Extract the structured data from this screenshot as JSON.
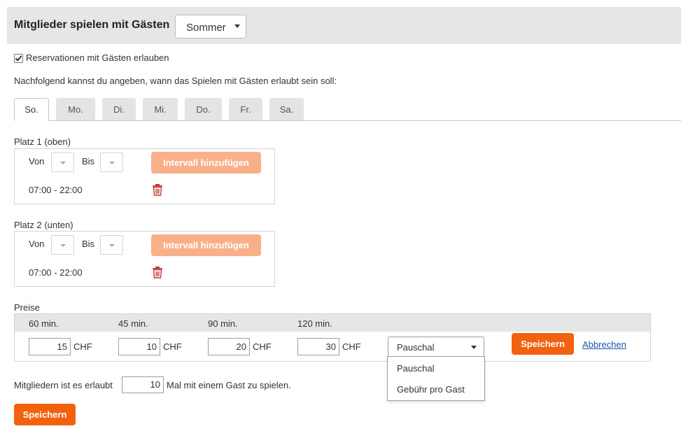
{
  "header": {
    "title": "Mitglieder spielen mit Gästen",
    "season_value": "Sommer"
  },
  "allow_guests": {
    "checked": true,
    "label": "Reservationen mit Gästen erlauben"
  },
  "intro_text": "Nachfolgend kannst du angeben, wann das Spielen mit Gästen erlaubt sein soll:",
  "tabs": [
    {
      "label": "So.",
      "active": true
    },
    {
      "label": "Mo.",
      "active": false
    },
    {
      "label": "Di.",
      "active": false
    },
    {
      "label": "Mi.",
      "active": false
    },
    {
      "label": "Do.",
      "active": false
    },
    {
      "label": "Fr.",
      "active": false
    },
    {
      "label": "Sa.",
      "active": false
    }
  ],
  "courts": [
    {
      "label": "Platz 1 (oben)",
      "from_label": "Von",
      "to_label": "Bis",
      "add_button": "Intervall hinzufügen",
      "intervals": [
        "07:00 - 22:00"
      ]
    },
    {
      "label": "Platz 2 (unten)",
      "from_label": "Von",
      "to_label": "Bis",
      "add_button": "Intervall hinzufügen",
      "intervals": [
        "07:00 - 22:00"
      ]
    }
  ],
  "prices": {
    "label": "Preise",
    "currency": "CHF",
    "durations": [
      "60 min.",
      "45 min.",
      "90 min.",
      "120 min."
    ],
    "values": [
      "15",
      "10",
      "20",
      "30"
    ],
    "type_value": "Pauschal",
    "type_options": [
      "Pauschal",
      "Gebühr pro Gast"
    ],
    "save_label": "Speichern",
    "cancel_label": "Abbrechen"
  },
  "guest_limit": {
    "prefix": "Mitgliedern ist es erlaubt",
    "value": "10",
    "suffix": "Mal mit einem Gast zu spielen."
  },
  "save_label": "Speichern",
  "colors": {
    "accent": "#f2610e",
    "accent_disabled": "#f9b08a",
    "delete_icon": "#c0392b",
    "link": "#1a55a8"
  },
  "icons": {
    "delete": "trash-icon",
    "select": "chevron-down-icon"
  }
}
